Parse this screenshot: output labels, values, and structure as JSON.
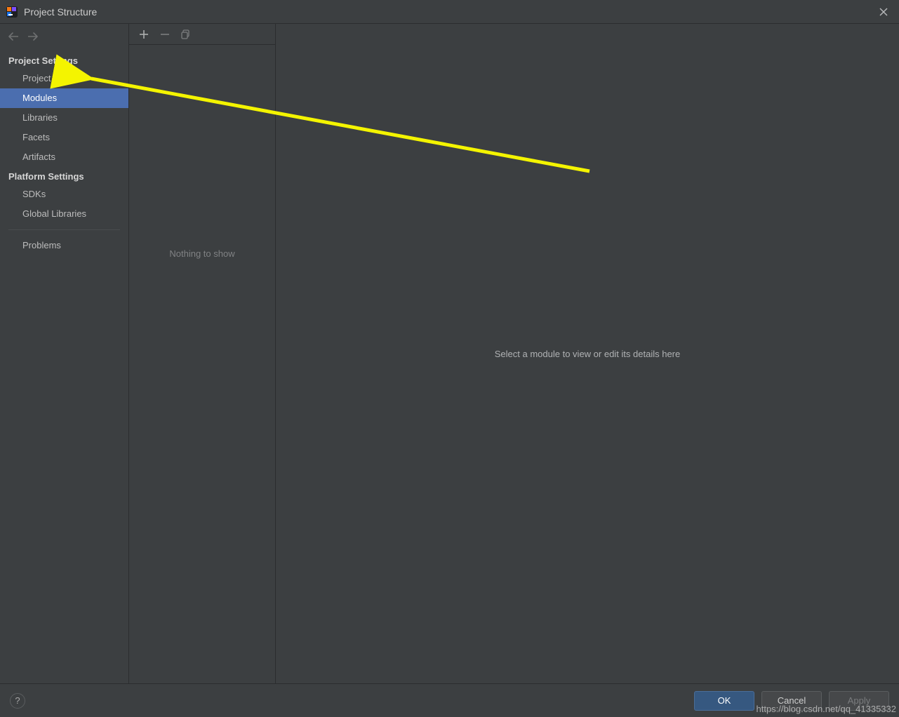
{
  "window": {
    "title": "Project Structure"
  },
  "sidebar": {
    "back_label": "Back",
    "forward_label": "Forward",
    "sections": [
      {
        "title": "Project Settings",
        "items": [
          {
            "label": "Project",
            "selected": false
          },
          {
            "label": "Modules",
            "selected": true
          },
          {
            "label": "Libraries",
            "selected": false
          },
          {
            "label": "Facets",
            "selected": false
          },
          {
            "label": "Artifacts",
            "selected": false
          }
        ]
      },
      {
        "title": "Platform Settings",
        "items": [
          {
            "label": "SDKs",
            "selected": false
          },
          {
            "label": "Global Libraries",
            "selected": false
          }
        ]
      }
    ],
    "extra": [
      {
        "label": "Problems"
      }
    ]
  },
  "module_list": {
    "toolbar": {
      "add_label": "Add",
      "remove_label": "Remove",
      "copy_label": "Copy"
    },
    "empty_text": "Nothing to show"
  },
  "detail": {
    "hint": "Select a module to view or edit its details here"
  },
  "footer": {
    "help_label": "Help",
    "ok_label": "OK",
    "cancel_label": "Cancel",
    "apply_label": "Apply"
  },
  "watermark": "https://blog.csdn.net/qq_41335332"
}
